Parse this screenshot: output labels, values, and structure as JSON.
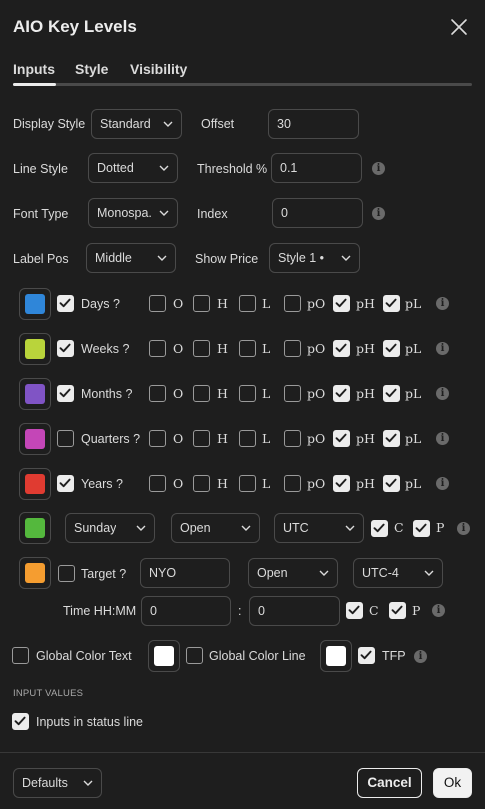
{
  "dialog": {
    "title": "AIO Key Levels"
  },
  "tabs": [
    "Inputs",
    "Style",
    "Visibility"
  ],
  "inputs": {
    "display_style": {
      "label": "Display Style",
      "value": "Standard"
    },
    "offset": {
      "label": "Offset",
      "value": "30"
    },
    "line_style": {
      "label": "Line Style",
      "value": "Dotted"
    },
    "threshold": {
      "label": "Threshold %",
      "value": "0.1"
    },
    "font_type": {
      "label": "Font Type",
      "value": "Monospa..."
    },
    "index": {
      "label": "Index",
      "value": "0"
    },
    "label_pos": {
      "label": "Label Pos",
      "value": "Middle"
    },
    "show_price": {
      "label": "Show Price",
      "value": "Style 1 •"
    }
  },
  "timeframe_rows": [
    {
      "label": "Days ?",
      "color": "#2f86d9",
      "enabled": true,
      "checks": [
        false,
        false,
        false,
        false,
        true,
        true
      ]
    },
    {
      "label": "Weeks ?",
      "color": "#b9d43b",
      "enabled": true,
      "checks": [
        false,
        false,
        false,
        false,
        true,
        true
      ]
    },
    {
      "label": "Months ?",
      "color": "#8054c5",
      "enabled": true,
      "checks": [
        false,
        false,
        false,
        false,
        true,
        true
      ]
    },
    {
      "label": "Quarters ?",
      "color": "#c446b7",
      "enabled": false,
      "checks": [
        false,
        false,
        false,
        false,
        true,
        true
      ]
    },
    {
      "label": "Years ?",
      "color": "#e03b31",
      "enabled": true,
      "checks": [
        false,
        false,
        false,
        false,
        true,
        true
      ]
    }
  ],
  "check_labels": [
    "O",
    "H",
    "L",
    "pO",
    "pH",
    "pL"
  ],
  "session_row": {
    "color": "#54b83d",
    "day": "Sunday",
    "mode": "Open",
    "tz": "UTC",
    "c_label": "C",
    "c": true,
    "p_label": "P",
    "p": true
  },
  "target_row": {
    "color": "#f59d30",
    "label": "Target ?",
    "enabled": false,
    "market": "NYO",
    "mode": "Open",
    "tz": "UTC-4"
  },
  "time_row": {
    "label": "Time HH:MM",
    "hh": "0",
    "sep": ":",
    "mm": "0",
    "c_label": "C",
    "c": true,
    "p_label": "P",
    "p": true
  },
  "global": {
    "color_text": {
      "label": "Global Color Text",
      "checked": false,
      "color": "#ffffff"
    },
    "color_line": {
      "label": "Global Color Line",
      "checked": false,
      "color": "#ffffff"
    },
    "tfp": {
      "label": "TFP",
      "checked": true
    }
  },
  "input_values": {
    "section": "INPUT VALUES",
    "status_line": {
      "label": "Inputs in status line",
      "checked": true
    }
  },
  "footer": {
    "defaults": "Defaults",
    "cancel": "Cancel",
    "ok": "Ok"
  }
}
